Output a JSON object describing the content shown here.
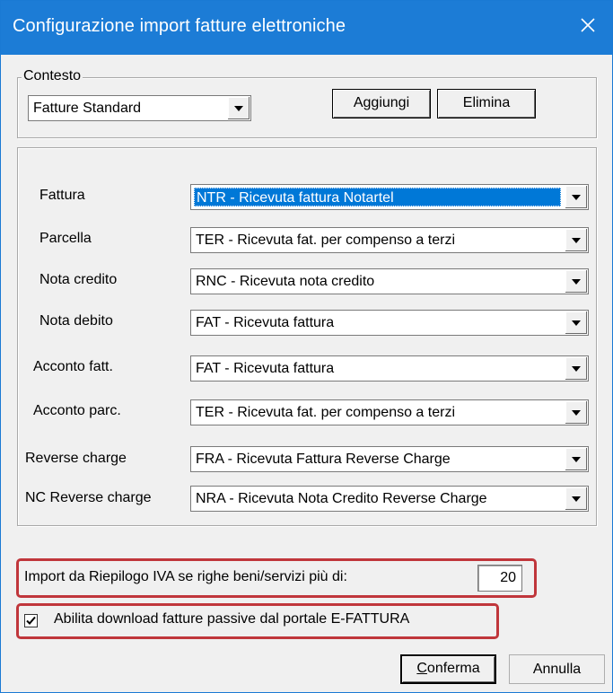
{
  "window": {
    "title": "Configurazione import fatture elettroniche",
    "close_icon": "close-icon"
  },
  "contesto": {
    "label": "Contesto",
    "value": "Fatture Standard",
    "add_label": "Aggiungi",
    "delete_label": "Elimina"
  },
  "mappings": [
    {
      "label": "Fattura",
      "value": "NTR - Ricevuta fattura Notartel"
    },
    {
      "label": "Parcella",
      "value": "TER - Ricevuta fat. per compenso a terzi"
    },
    {
      "label": "Nota credito",
      "value": "RNC - Ricevuta nota credito"
    },
    {
      "label": "Nota debito",
      "value": "FAT - Ricevuta fattura"
    },
    {
      "label": "Acconto fatt.",
      "value": "FAT - Ricevuta fattura"
    },
    {
      "label": "Acconto parc.",
      "value": "TER - Ricevuta fat. per compenso a terzi"
    },
    {
      "label": "Reverse charge",
      "value": "FRA - Ricevuta Fattura Reverse Charge"
    },
    {
      "label": "NC Reverse charge",
      "value": "NRA - Ricevuta Nota Credito Reverse Charge"
    }
  ],
  "riepilogo": {
    "label": "Import da Riepilogo IVA se righe beni/servizi più di:",
    "value": "20"
  },
  "download": {
    "label": "Abilita download fatture passive dal portale E-FATTURA",
    "checked": true
  },
  "footer": {
    "confirm_first": "C",
    "confirm_rest": "onferma",
    "cancel_label": "Annulla"
  },
  "colors": {
    "titlebar": "#1c7cd6",
    "selection": "#0078d7",
    "highlight": "#c0363b"
  }
}
